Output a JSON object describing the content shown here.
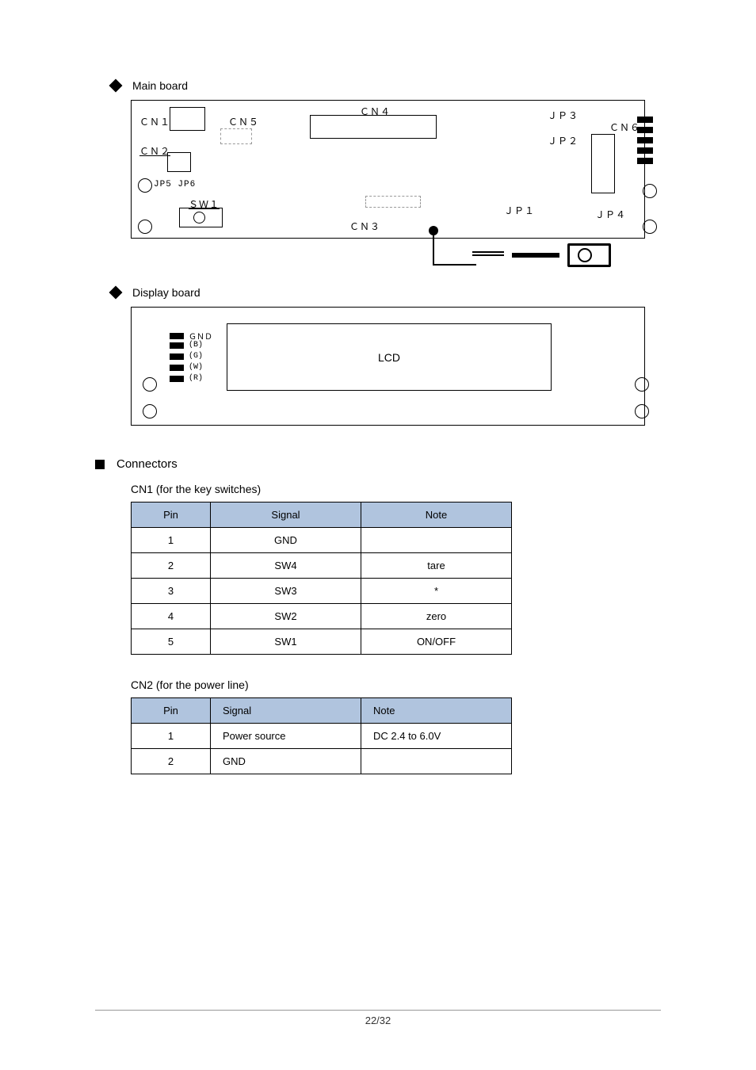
{
  "sections": {
    "main_board": "Main board",
    "display_board": "Display board"
  },
  "main_diagram": {
    "cn1": "ＣＮ１",
    "cn2": "ＣＮ２",
    "cn3": "ＣＮ３",
    "cn4": "ＣＮ４",
    "cn5": "ＣＮ５",
    "cn6": "ＣＮ６",
    "jp1": "ＪＰ１",
    "jp2": "ＪＰ２",
    "jp3": "ＪＰ３",
    "jp4": "ＪＰ４",
    "jp5jp6": "JP5 JP6",
    "sw1": "ＳＷ１"
  },
  "display_diagram": {
    "lcd": "LCD",
    "pins": {
      "gnd": "ＧＮＤ",
      "b": "(B)",
      "g": "(G)",
      "w": "(W)",
      "r": "(R)"
    }
  },
  "connectors_title": "Connectors",
  "table1": {
    "title": "CN1 (for the key switches)",
    "headers": {
      "pin": "Pin",
      "signal": "Signal",
      "note": "Note"
    },
    "rows": [
      {
        "pin": "1",
        "signal": "GND",
        "note": ""
      },
      {
        "pin": "2",
        "signal": "SW4",
        "note": "tare"
      },
      {
        "pin": "3",
        "signal": "SW3",
        "note": "*"
      },
      {
        "pin": "4",
        "signal": "SW2",
        "note": "zero"
      },
      {
        "pin": "5",
        "signal": "SW1",
        "note": "ON/OFF"
      }
    ]
  },
  "table2": {
    "title": "CN2 (for the power line)",
    "headers": {
      "pin": "Pin",
      "signal": "Signal",
      "note": "Note"
    },
    "rows": [
      {
        "pin": "1",
        "signal": "Power source",
        "note": "DC 2.4 to 6.0V"
      },
      {
        "pin": "2",
        "signal": "GND",
        "note": ""
      }
    ]
  },
  "footer": "22/32"
}
